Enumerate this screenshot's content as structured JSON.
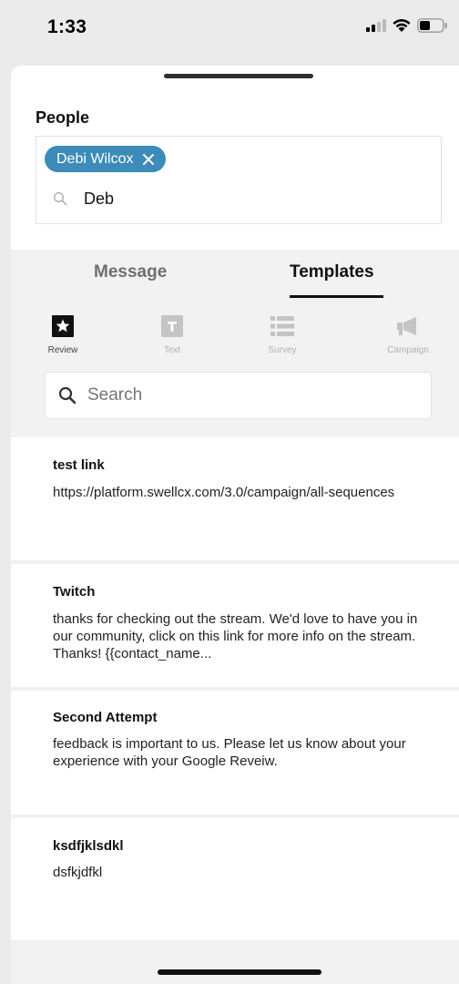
{
  "status_bar": {
    "time": "1:33",
    "icons": [
      "cellular-signal-icon",
      "wifi-icon",
      "battery-icon"
    ]
  },
  "people": {
    "label": "People",
    "chips": [
      {
        "label": "Debi Wilcox",
        "remove_icon": "close-icon"
      }
    ],
    "search_value": "Deb",
    "search_icon": "search-icon"
  },
  "tabs": [
    {
      "label": "Message",
      "active": false
    },
    {
      "label": "Templates",
      "active": true
    }
  ],
  "template_types": [
    {
      "label": "Review",
      "icon": "star-icon",
      "active": true
    },
    {
      "label": "Text",
      "icon": "text-icon",
      "active": false
    },
    {
      "label": "Survey",
      "icon": "list-icon",
      "active": false
    },
    {
      "label": "Campaign",
      "icon": "megaphone-icon",
      "active": false
    }
  ],
  "template_search": {
    "placeholder": "Search",
    "icon": "search-icon"
  },
  "templates": [
    {
      "title": "test link",
      "body": "https://platform.swellcx.com/3.0/campaign/all-sequences"
    },
    {
      "title": "Twitch",
      "body": "thanks for checking out the stream. We'd love to have you in our community, click on this link for more info on the stream. Thanks! {{contact_name..."
    },
    {
      "title": "Second Attempt",
      "body": "feedback is important to us. Please let us know about your experience with your Google Reveiw."
    },
    {
      "title": "ksdfjklsdkl",
      "body": "dsfkjdfkl"
    }
  ],
  "colors": {
    "chip": "#3d8bb8",
    "panel": "#f2f2f2",
    "active_tab": "#111111",
    "inactive_tab": "#6f6f6f"
  }
}
